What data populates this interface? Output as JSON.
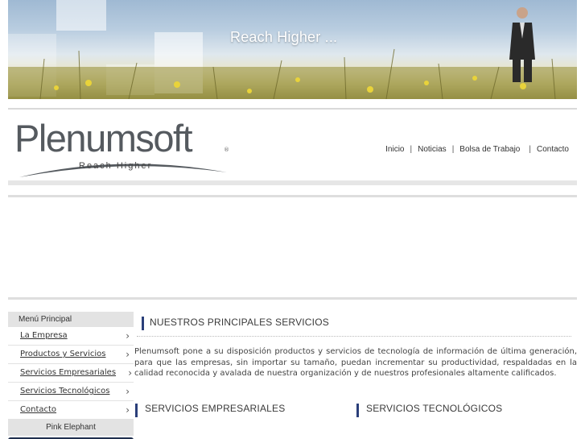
{
  "banner": {
    "tagline": "Reach Higher ..."
  },
  "header": {
    "logo_text": "Plenumsoft",
    "logo_tagline": "Reach Higher",
    "logo_mark": "®",
    "nav": [
      "Inicio",
      "Noticias",
      "Bolsa de Trabajo",
      "Contacto"
    ]
  },
  "sidebar": {
    "heading": "Menú Principal",
    "items": [
      {
        "label": "La Empresa"
      },
      {
        "label": "Productos y Servicios"
      },
      {
        "label": "Servicios Empresariales"
      },
      {
        "label": "Servicios Tecnológicos"
      },
      {
        "label": "Contacto"
      }
    ],
    "footer": "Pink Elephant"
  },
  "main": {
    "title": "NUESTROS PRINCIPALES SERVICIOS",
    "intro": "Plenumsoft pone a su disposición productos y servicios de tecnología de información de última generación, para que las empresas, sin importar su tamaño, puedan incrementar su productividad, respaldadas en la calidad reconocida y avalada de nuestra organización y de nuestros profesionales altamente calificados.",
    "col_left": "SERVICIOS EMPRESARIALES",
    "col_right": "SERVICIOS TECNOLÓGICOS"
  },
  "colors": {
    "accent_bar": "#2b3f7a",
    "menu_bg": "#e3e3e3",
    "footer_bar": "#1f2f4e"
  }
}
